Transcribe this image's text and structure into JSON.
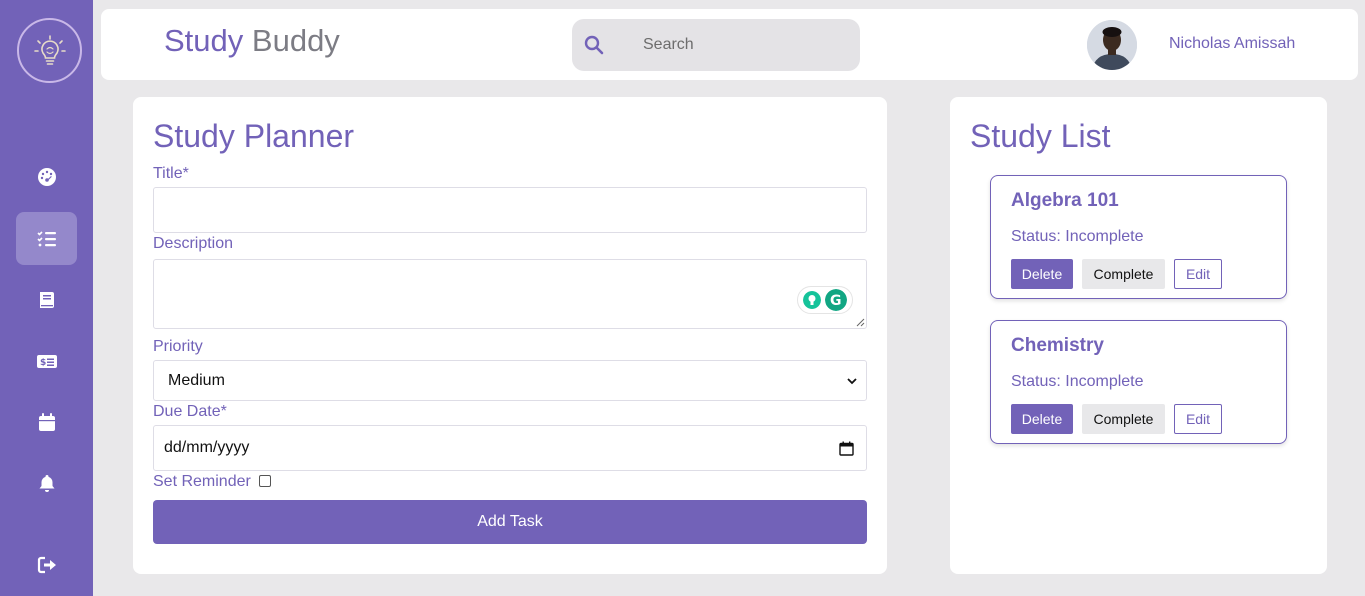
{
  "app": {
    "title_part1": "Study",
    "title_part2": "Buddy"
  },
  "search": {
    "placeholder": "Search"
  },
  "user": {
    "name": "Nicholas Amissah"
  },
  "sidebar": {
    "items": [
      {
        "icon": "dashboard-icon",
        "active": false
      },
      {
        "icon": "tasks-icon",
        "active": true
      },
      {
        "icon": "book-icon",
        "active": false
      },
      {
        "icon": "money-icon",
        "active": false
      },
      {
        "icon": "calendar-icon",
        "active": false
      },
      {
        "icon": "bell-icon",
        "active": false
      },
      {
        "icon": "logout-icon",
        "active": false
      }
    ]
  },
  "planner": {
    "heading": "Study Planner",
    "title_label": "Title*",
    "title_value": "",
    "description_label": "Description",
    "description_value": "",
    "priority_label": "Priority",
    "priority_value": "Medium",
    "due_label": "Due Date*",
    "due_placeholder": "dd/mm/yyyy",
    "reminder_label": "Set Reminder",
    "reminder_checked": false,
    "add_button": "Add Task"
  },
  "study_list": {
    "heading": "Study List",
    "tasks": [
      {
        "title": "Algebra 101",
        "status": "Status: Incomplete",
        "delete": "Delete",
        "complete": "Complete",
        "edit": "Edit"
      },
      {
        "title": "Chemistry",
        "status": "Status: Incomplete",
        "delete": "Delete",
        "complete": "Complete",
        "edit": "Edit"
      }
    ]
  },
  "colors": {
    "accent": "#7262b8",
    "sidebar_active": "#9488cb",
    "background": "#e9e8ea"
  }
}
